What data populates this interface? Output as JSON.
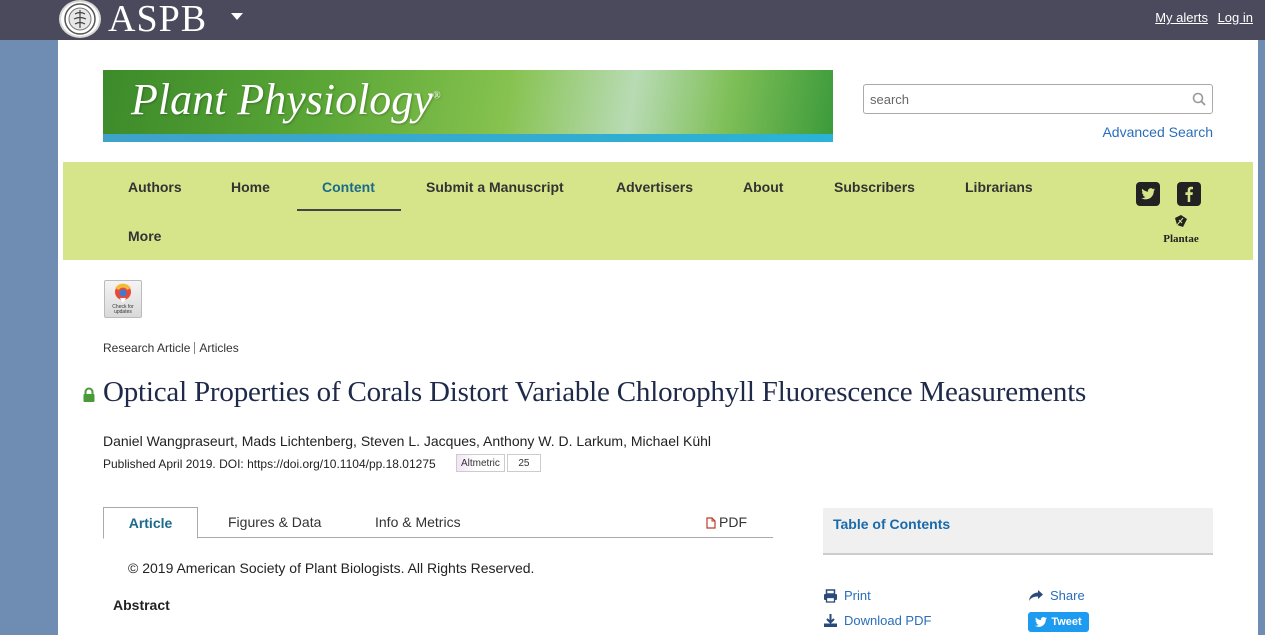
{
  "topbar": {
    "brand": "ASPB",
    "links": [
      "My alerts",
      "Log in"
    ]
  },
  "journal": {
    "title": "Plant Physiology",
    "registered": "®"
  },
  "search": {
    "placeholder": "search",
    "advanced_label": "Advanced Search"
  },
  "nav": {
    "items": [
      "Authors",
      "Home",
      "Content",
      "Submit a Manuscript",
      "Advertisers",
      "About",
      "Subscribers",
      "Librarians",
      "More"
    ],
    "active": "Content",
    "plantae_label": "Plantae"
  },
  "crossmark": {
    "label": "Check for updates"
  },
  "breadcrumb": [
    "Research Article",
    "Articles"
  ],
  "article": {
    "title": "Optical Properties of Corals Distort Variable Chlorophyll Fluorescence Measurements",
    "authors": "Daniel Wangpraseurt, Mads Lichtenberg, Steven L. Jacques, Anthony W. D. Larkum, Michael Kühl",
    "published": "Published April 2019. DOI: https://doi.org/10.1104/pp.18.01275",
    "altmetric_label": "Altmetric",
    "altmetric_score": "25"
  },
  "tabs": [
    "Article",
    "Figures & Data",
    "Info & Metrics",
    "PDF"
  ],
  "body": {
    "copyright": "© 2019 American Society of Plant Biologists. All Rights Reserved.",
    "abstract_heading": "Abstract"
  },
  "sidebar": {
    "toc_label": "Table of Contents",
    "print": "Print",
    "share": "Share",
    "download_pdf": "Download PDF",
    "tweet": "Tweet"
  },
  "colors": {
    "topbar": "#4a4a5c",
    "background": "#6f8db2",
    "nav_bg": "#d7e58a",
    "link": "#2a6ebb",
    "active_nav": "#1a6a8a",
    "title": "#1f2a4a",
    "lock": "#4a9a3a",
    "tweet": "#1d9bf0"
  }
}
